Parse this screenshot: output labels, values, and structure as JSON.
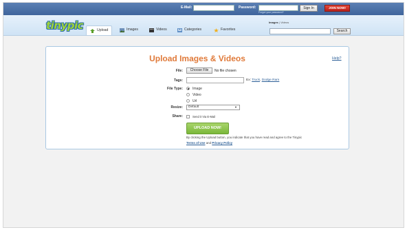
{
  "topbar": {
    "email_label": "E-Mail:",
    "password_label": "Password:",
    "forgot_text": "Forgot your password?",
    "sign_in": "Sign In",
    "join_now": "JOIN NOW!"
  },
  "nav": {
    "logo": "tinypic",
    "tabs": [
      {
        "label": "Upload",
        "icon": "upload-arrow-icon"
      },
      {
        "label": "Images",
        "icon": "images-icon"
      },
      {
        "label": "Videos",
        "icon": "film-icon"
      },
      {
        "label": "Categories",
        "icon": "categories-icon"
      },
      {
        "label": "Favorites",
        "icon": "star-icon"
      }
    ],
    "search_scope_images": "Images",
    "search_scope_sep": " | ",
    "search_scope_videos": "Videos",
    "search_button": "Search"
  },
  "upload": {
    "title": "Upload Images & Videos",
    "help": "Help?",
    "file_label": "File:",
    "choose_file": "Choose File",
    "no_file": "No file chosen",
    "tags_label": "Tags:",
    "tags_example_prefix": "Ex:",
    "tags_example_1": "Truck",
    "tags_example_2": "Dodge Ram",
    "filetype_label": "File Type:",
    "filetype_options": [
      "Image",
      "Video",
      "Url"
    ],
    "filetype_selected": "Image",
    "resize_label": "Resize:",
    "resize_value": "Default",
    "share_label": "Share:",
    "share_option": "Send it Via E-Mail",
    "upload_button": "UPLOAD NOW!",
    "legal_text": "By clicking the Upload button, you indicate that you have read and agree to the Tinypic",
    "terms": "Terms of Use",
    "and": "and",
    "privacy": "Privacy Policy"
  },
  "colors": {
    "topbar": "#4a6fa8",
    "title_orange": "#e07a3a",
    "upload_green": "#8cc44a",
    "join_red": "#c8281f",
    "link_blue": "#2c5f97"
  }
}
